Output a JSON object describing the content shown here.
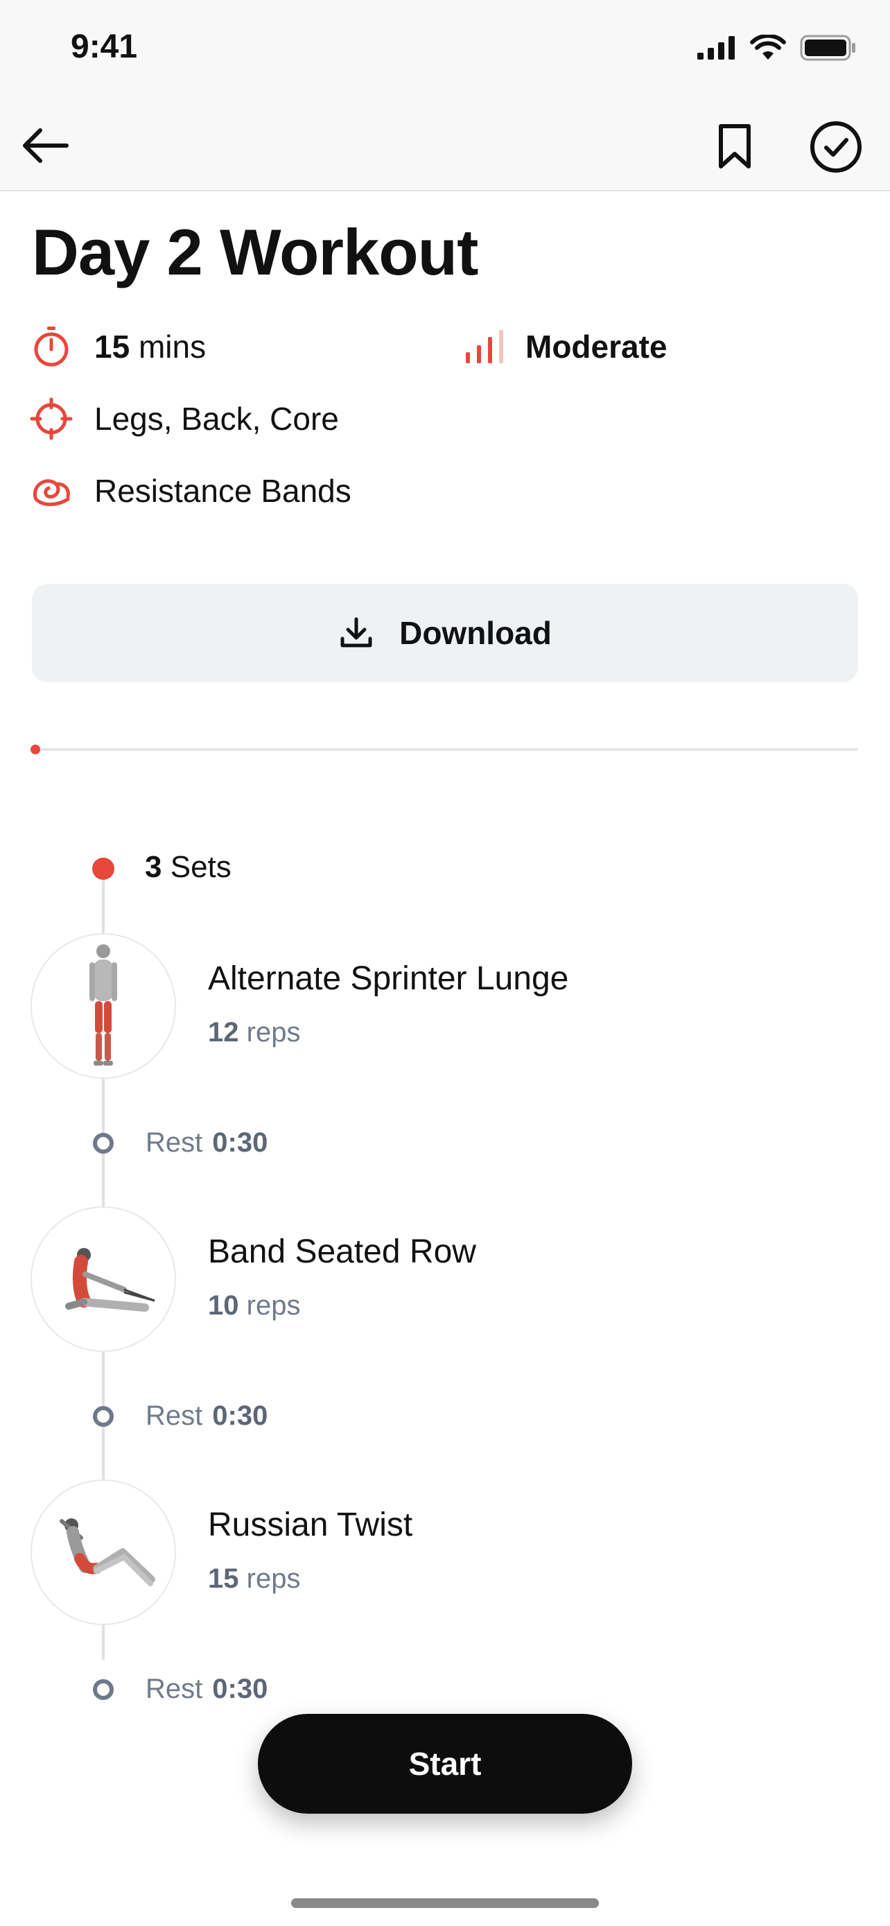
{
  "status_bar": {
    "time": "9:41"
  },
  "nav": {
    "back_icon": "arrow-left-icon",
    "bookmark_icon": "bookmark-icon",
    "complete_icon": "check-circle-icon"
  },
  "workout": {
    "title": "Day 2 Workout",
    "duration_value": "15",
    "duration_unit": "mins",
    "difficulty": "Moderate",
    "muscles": "Legs, Back, Core",
    "equipment": "Resistance Bands"
  },
  "download": {
    "label": "Download"
  },
  "progress": {
    "fraction": 0.0
  },
  "circuit": {
    "sets_count": "3",
    "sets_label": "Sets",
    "exercises": [
      {
        "name": "Alternate Sprinter Lunge",
        "reps_value": "12",
        "reps_unit": "reps"
      },
      {
        "name": "Band Seated Row",
        "reps_value": "10",
        "reps_unit": "reps"
      },
      {
        "name": "Russian Twist",
        "reps_value": "15",
        "reps_unit": "reps"
      }
    ],
    "rests": [
      {
        "label": "Rest",
        "time": "0:30"
      },
      {
        "label": "Rest",
        "time": "0:30"
      },
      {
        "label": "Rest",
        "time": "0:30"
      }
    ]
  },
  "start": {
    "label": "Start"
  },
  "colors": {
    "accent": "#e8473b",
    "muted": "#707b8a",
    "button_bg": "#eff2f5",
    "start_bg": "#0d0d0d"
  }
}
